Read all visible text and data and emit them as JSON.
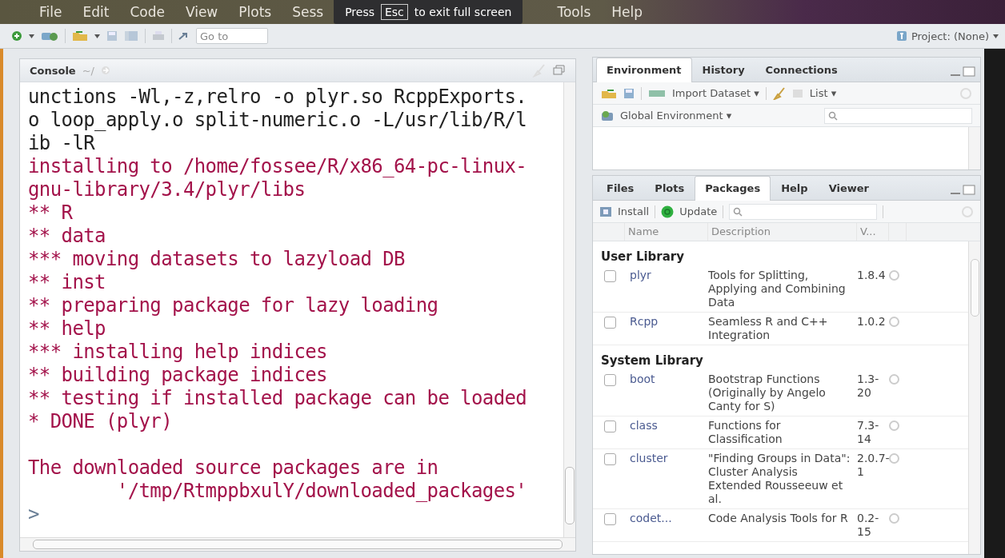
{
  "menu": [
    {
      "label": "File"
    },
    {
      "label": "Edit"
    },
    {
      "label": "Code"
    },
    {
      "label": "View"
    },
    {
      "label": "Plots"
    },
    {
      "label": "Sess"
    },
    {
      "label": "Tools"
    },
    {
      "label": "Help"
    }
  ],
  "fullscreen_notice": {
    "before": "Press",
    "key": "Esc",
    "after": "to exit full screen"
  },
  "toolbar": {
    "goto_placeholder": "Go to",
    "project": "Project: (None)"
  },
  "console": {
    "title": "Console",
    "path": "~/",
    "blocks": [
      {
        "lines": [
          {
            "kind": "output",
            "text": "unctions -Wl,-z,relro -o plyr.so RcppExports."
          },
          {
            "kind": "output",
            "text": "o loop_apply.o split-numeric.o -L/usr/lib/R/l"
          },
          {
            "kind": "output",
            "text": "ib -lR"
          },
          {
            "kind": "message",
            "text": "installing to /home/fossee/R/x86_64-pc-linux-"
          },
          {
            "kind": "message",
            "text": "gnu-library/3.4/plyr/libs"
          },
          {
            "kind": "message",
            "text": "** R"
          },
          {
            "kind": "message",
            "text": "** data"
          },
          {
            "kind": "message",
            "text": "*** moving datasets to lazyload DB"
          },
          {
            "kind": "message",
            "text": "** inst"
          },
          {
            "kind": "message",
            "text": "** preparing package for lazy loading"
          },
          {
            "kind": "message",
            "text": "** help"
          },
          {
            "kind": "message",
            "text": "*** installing help indices"
          },
          {
            "kind": "message",
            "text": "** building package indices"
          },
          {
            "kind": "message",
            "text": "** testing if installed package can be loaded"
          },
          {
            "kind": "message",
            "text": "* DONE (plyr)"
          }
        ]
      },
      {
        "lines": [
          {
            "kind": "message",
            "text": "The downloaded source packages are in"
          },
          {
            "kind": "message",
            "text": "        '/tmp/RtmppbxulY/downloaded_packages'"
          },
          {
            "kind": "prompt",
            "text": ">"
          }
        ]
      }
    ]
  },
  "environment_pane": {
    "tabs": [
      {
        "label": "Environment",
        "selected": true
      },
      {
        "label": "History",
        "selected": false
      },
      {
        "label": "Connections",
        "selected": false
      }
    ],
    "import_button": "Import Dataset ▾",
    "list_button": "List ▾",
    "scope": "Global Environment ▾"
  },
  "packages_pane": {
    "tabs": [
      {
        "label": "Files",
        "selected": false
      },
      {
        "label": "Plots",
        "selected": false
      },
      {
        "label": "Packages",
        "selected": true
      },
      {
        "label": "Help",
        "selected": false
      },
      {
        "label": "Viewer",
        "selected": false
      }
    ],
    "install_button": "Install",
    "update_button": "Update",
    "columns": [
      "Name",
      "Description",
      "V..."
    ],
    "groups": [
      {
        "title": "User Library",
        "packages": [
          {
            "name": "plyr",
            "description": "Tools for Splitting, Applying and Combining Data",
            "version": "1.8.4",
            "checked": false
          },
          {
            "name": "Rcpp",
            "description": "Seamless R and C++ Integration",
            "version": "1.0.2",
            "checked": false
          }
        ]
      },
      {
        "title": "System Library",
        "packages": [
          {
            "name": "boot",
            "description": "Bootstrap Functions (Originally by Angelo Canty for S)",
            "version": "1.3-20",
            "checked": false
          },
          {
            "name": "class",
            "description": "Functions for Classification",
            "version": "7.3-14",
            "checked": false
          },
          {
            "name": "cluster",
            "description": "\"Finding Groups in Data\": Cluster Analysis Extended Rousseeuw et al.",
            "version": "2.0.7-1",
            "checked": false
          },
          {
            "name": "codet...",
            "description": "Code Analysis Tools for R",
            "version": "0.2-15",
            "checked": false
          }
        ]
      }
    ]
  }
}
